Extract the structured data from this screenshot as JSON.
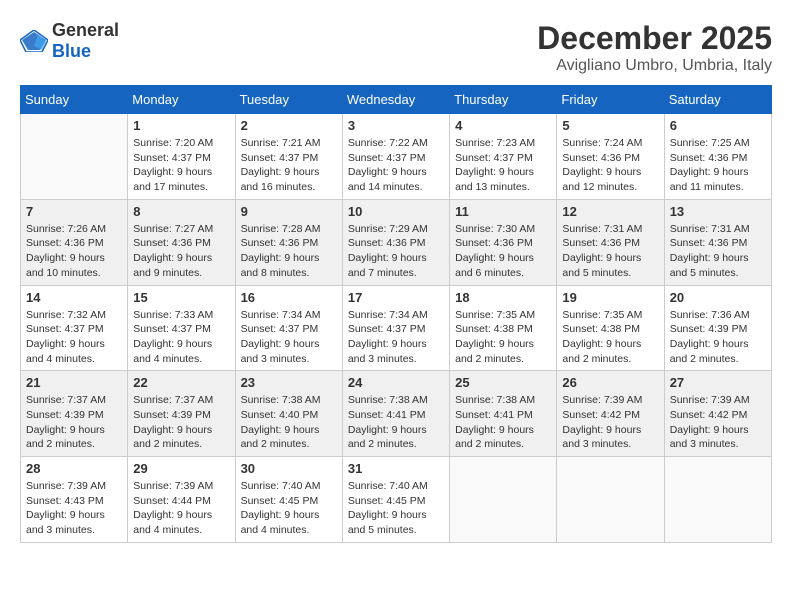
{
  "header": {
    "logo_general": "General",
    "logo_blue": "Blue",
    "month_year": "December 2025",
    "location": "Avigliano Umbro, Umbria, Italy"
  },
  "weekdays": [
    "Sunday",
    "Monday",
    "Tuesday",
    "Wednesday",
    "Thursday",
    "Friday",
    "Saturday"
  ],
  "weeks": [
    [
      {
        "day": "",
        "info": ""
      },
      {
        "day": "1",
        "info": "Sunrise: 7:20 AM\nSunset: 4:37 PM\nDaylight: 9 hours\nand 17 minutes."
      },
      {
        "day": "2",
        "info": "Sunrise: 7:21 AM\nSunset: 4:37 PM\nDaylight: 9 hours\nand 16 minutes."
      },
      {
        "day": "3",
        "info": "Sunrise: 7:22 AM\nSunset: 4:37 PM\nDaylight: 9 hours\nand 14 minutes."
      },
      {
        "day": "4",
        "info": "Sunrise: 7:23 AM\nSunset: 4:37 PM\nDaylight: 9 hours\nand 13 minutes."
      },
      {
        "day": "5",
        "info": "Sunrise: 7:24 AM\nSunset: 4:36 PM\nDaylight: 9 hours\nand 12 minutes."
      },
      {
        "day": "6",
        "info": "Sunrise: 7:25 AM\nSunset: 4:36 PM\nDaylight: 9 hours\nand 11 minutes."
      }
    ],
    [
      {
        "day": "7",
        "info": "Sunrise: 7:26 AM\nSunset: 4:36 PM\nDaylight: 9 hours\nand 10 minutes."
      },
      {
        "day": "8",
        "info": "Sunrise: 7:27 AM\nSunset: 4:36 PM\nDaylight: 9 hours\nand 9 minutes."
      },
      {
        "day": "9",
        "info": "Sunrise: 7:28 AM\nSunset: 4:36 PM\nDaylight: 9 hours\nand 8 minutes."
      },
      {
        "day": "10",
        "info": "Sunrise: 7:29 AM\nSunset: 4:36 PM\nDaylight: 9 hours\nand 7 minutes."
      },
      {
        "day": "11",
        "info": "Sunrise: 7:30 AM\nSunset: 4:36 PM\nDaylight: 9 hours\nand 6 minutes."
      },
      {
        "day": "12",
        "info": "Sunrise: 7:31 AM\nSunset: 4:36 PM\nDaylight: 9 hours\nand 5 minutes."
      },
      {
        "day": "13",
        "info": "Sunrise: 7:31 AM\nSunset: 4:36 PM\nDaylight: 9 hours\nand 5 minutes."
      }
    ],
    [
      {
        "day": "14",
        "info": "Sunrise: 7:32 AM\nSunset: 4:37 PM\nDaylight: 9 hours\nand 4 minutes."
      },
      {
        "day": "15",
        "info": "Sunrise: 7:33 AM\nSunset: 4:37 PM\nDaylight: 9 hours\nand 4 minutes."
      },
      {
        "day": "16",
        "info": "Sunrise: 7:34 AM\nSunset: 4:37 PM\nDaylight: 9 hours\nand 3 minutes."
      },
      {
        "day": "17",
        "info": "Sunrise: 7:34 AM\nSunset: 4:37 PM\nDaylight: 9 hours\nand 3 minutes."
      },
      {
        "day": "18",
        "info": "Sunrise: 7:35 AM\nSunset: 4:38 PM\nDaylight: 9 hours\nand 2 minutes."
      },
      {
        "day": "19",
        "info": "Sunrise: 7:35 AM\nSunset: 4:38 PM\nDaylight: 9 hours\nand 2 minutes."
      },
      {
        "day": "20",
        "info": "Sunrise: 7:36 AM\nSunset: 4:39 PM\nDaylight: 9 hours\nand 2 minutes."
      }
    ],
    [
      {
        "day": "21",
        "info": "Sunrise: 7:37 AM\nSunset: 4:39 PM\nDaylight: 9 hours\nand 2 minutes."
      },
      {
        "day": "22",
        "info": "Sunrise: 7:37 AM\nSunset: 4:39 PM\nDaylight: 9 hours\nand 2 minutes."
      },
      {
        "day": "23",
        "info": "Sunrise: 7:38 AM\nSunset: 4:40 PM\nDaylight: 9 hours\nand 2 minutes."
      },
      {
        "day": "24",
        "info": "Sunrise: 7:38 AM\nSunset: 4:41 PM\nDaylight: 9 hours\nand 2 minutes."
      },
      {
        "day": "25",
        "info": "Sunrise: 7:38 AM\nSunset: 4:41 PM\nDaylight: 9 hours\nand 2 minutes."
      },
      {
        "day": "26",
        "info": "Sunrise: 7:39 AM\nSunset: 4:42 PM\nDaylight: 9 hours\nand 3 minutes."
      },
      {
        "day": "27",
        "info": "Sunrise: 7:39 AM\nSunset: 4:42 PM\nDaylight: 9 hours\nand 3 minutes."
      }
    ],
    [
      {
        "day": "28",
        "info": "Sunrise: 7:39 AM\nSunset: 4:43 PM\nDaylight: 9 hours\nand 3 minutes."
      },
      {
        "day": "29",
        "info": "Sunrise: 7:39 AM\nSunset: 4:44 PM\nDaylight: 9 hours\nand 4 minutes."
      },
      {
        "day": "30",
        "info": "Sunrise: 7:40 AM\nSunset: 4:45 PM\nDaylight: 9 hours\nand 4 minutes."
      },
      {
        "day": "31",
        "info": "Sunrise: 7:40 AM\nSunset: 4:45 PM\nDaylight: 9 hours\nand 5 minutes."
      },
      {
        "day": "",
        "info": ""
      },
      {
        "day": "",
        "info": ""
      },
      {
        "day": "",
        "info": ""
      }
    ]
  ]
}
